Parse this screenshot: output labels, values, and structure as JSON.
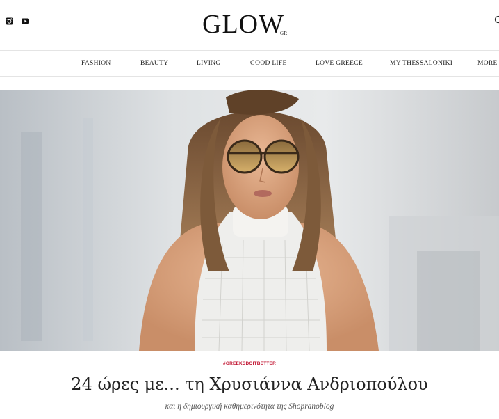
{
  "header": {
    "logo_text": "GLOW",
    "logo_sub": "GR",
    "social_icons": [
      "instagram-icon",
      "youtube-icon"
    ],
    "search_icon": "search-icon"
  },
  "nav": {
    "items": [
      "FASHION",
      "BEAUTY",
      "LIVING",
      "GOOD LIFE",
      "LOVE GREECE",
      "MY THESSALONIKI",
      "MORE"
    ]
  },
  "article": {
    "tag": "#GREEKSDOITBETTER",
    "title": "24 ώρες με... τη Χρυσιάννα Ανδριοπούλου",
    "subtitle": "και η δημιουργική καθημερινότητα της Shopranoblog"
  },
  "colors": {
    "tag": "#c0112e",
    "text": "#222222",
    "divider": "#e4e4e4"
  }
}
